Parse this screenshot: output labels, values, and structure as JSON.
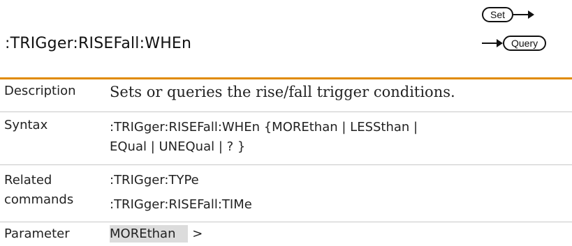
{
  "header": {
    "title": ":TRIGger:RISEFall:WHEn",
    "set_label": "Set",
    "query_label": "Query"
  },
  "rows": [
    {
      "label": "Description",
      "values": [
        "Sets or queries the rise/fall trigger conditions."
      ]
    },
    {
      "label": "Syntax",
      "values": [
        ":TRIGger:RISEFall:WHEn {MOREthan | LESSthan |",
        "EQual | UNEQual | ? }"
      ]
    },
    {
      "label": "Related commands",
      "label_lines": [
        "Related",
        "commands"
      ],
      "values": [
        ":TRIGger:TYPe",
        ":TRIGger:RISEFall:TIMe"
      ]
    },
    {
      "label": "Parameter",
      "values": [
        "MOREthan",
        ">"
      ]
    }
  ],
  "colors": {
    "accent_rule": "#e08a00",
    "row_rule": "#c8c8c8",
    "highlight": "#dcdcdc"
  },
  "icons": [
    "arrow-right-icon"
  ]
}
